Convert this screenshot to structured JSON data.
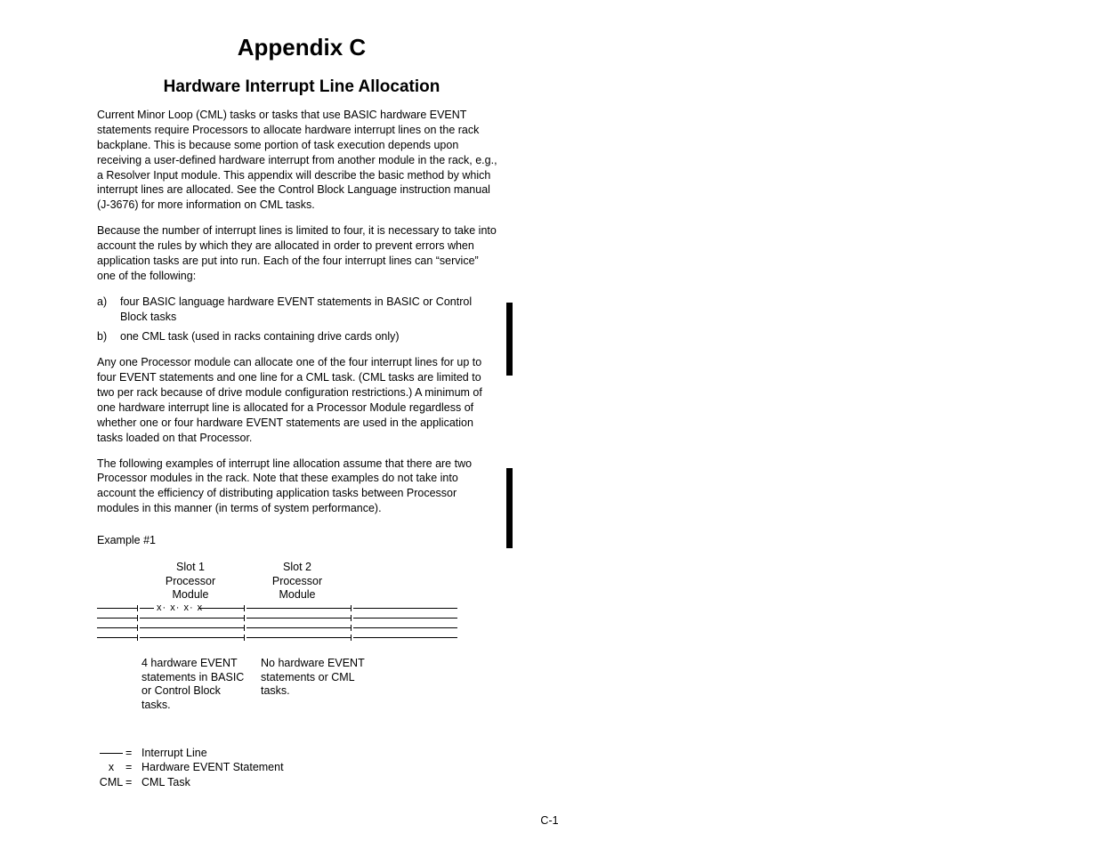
{
  "appendix_title": "Appendix C",
  "section_title": "Hardware Interrupt Line Allocation",
  "para1": "Current Minor Loop (CML) tasks or tasks that use BASIC hardware EVENT statements require Processors to allocate hardware interrupt lines on the rack backplane. This is because some portion of task execution depends upon receiving a user-defined hardware interrupt from another module in the rack, e.g., a Resolver Input module. This appendix will describe the basic method by which interrupt lines are allocated. See the Control Block Language instruction manual (J-3676) for more information on CML tasks.",
  "para2": "Because the number of interrupt lines is limited to four, it is necessary to take into account the rules by which they are allocated in order to prevent errors when application tasks are put into run. Each of the four interrupt lines can “service” one of the following:",
  "list_a_label": "a)",
  "list_a_text": "four BASIC language hardware EVENT statements in BASIC or Control Block tasks",
  "list_b_label": "b)",
  "list_b_text": "one CML task (used in racks containing drive cards only)",
  "para3": "Any one Processor module can allocate one of the four interrupt lines for up to four EVENT statements and one line for a CML task. (CML tasks are limited to two per rack because of drive module configuration restrictions.) A minimum of one hardware interrupt line is allocated for a Processor Module regardless of whether one or four hardware EVENT statements are used in the application tasks loaded on that Processor.",
  "para4": "The following examples of interrupt line allocation assume that there are two Processor modules in the rack. Note that these examples do not take into account the efficiency of distributing application tasks between Processor modules in this manner (in terms of system performance).",
  "example_label": "Example #1",
  "slot1": {
    "title": "Slot 1",
    "subtitle1": "Processor",
    "subtitle2": "Module",
    "desc": "4 hardware EVENT statements in BASIC or Control Block tasks."
  },
  "slot2": {
    "title": "Slot 2",
    "subtitle1": "Processor",
    "subtitle2": "Module",
    "desc": "No hardware EVENT statements or CML tasks."
  },
  "xmarks": "x· x· x· x",
  "legend": {
    "line_label": "Interrupt Line",
    "x_sym": "x",
    "x_label": "Hardware EVENT Statement",
    "cml_sym": "CML",
    "cml_label": "CML Task",
    "eq": "="
  },
  "page_number": "C-1"
}
